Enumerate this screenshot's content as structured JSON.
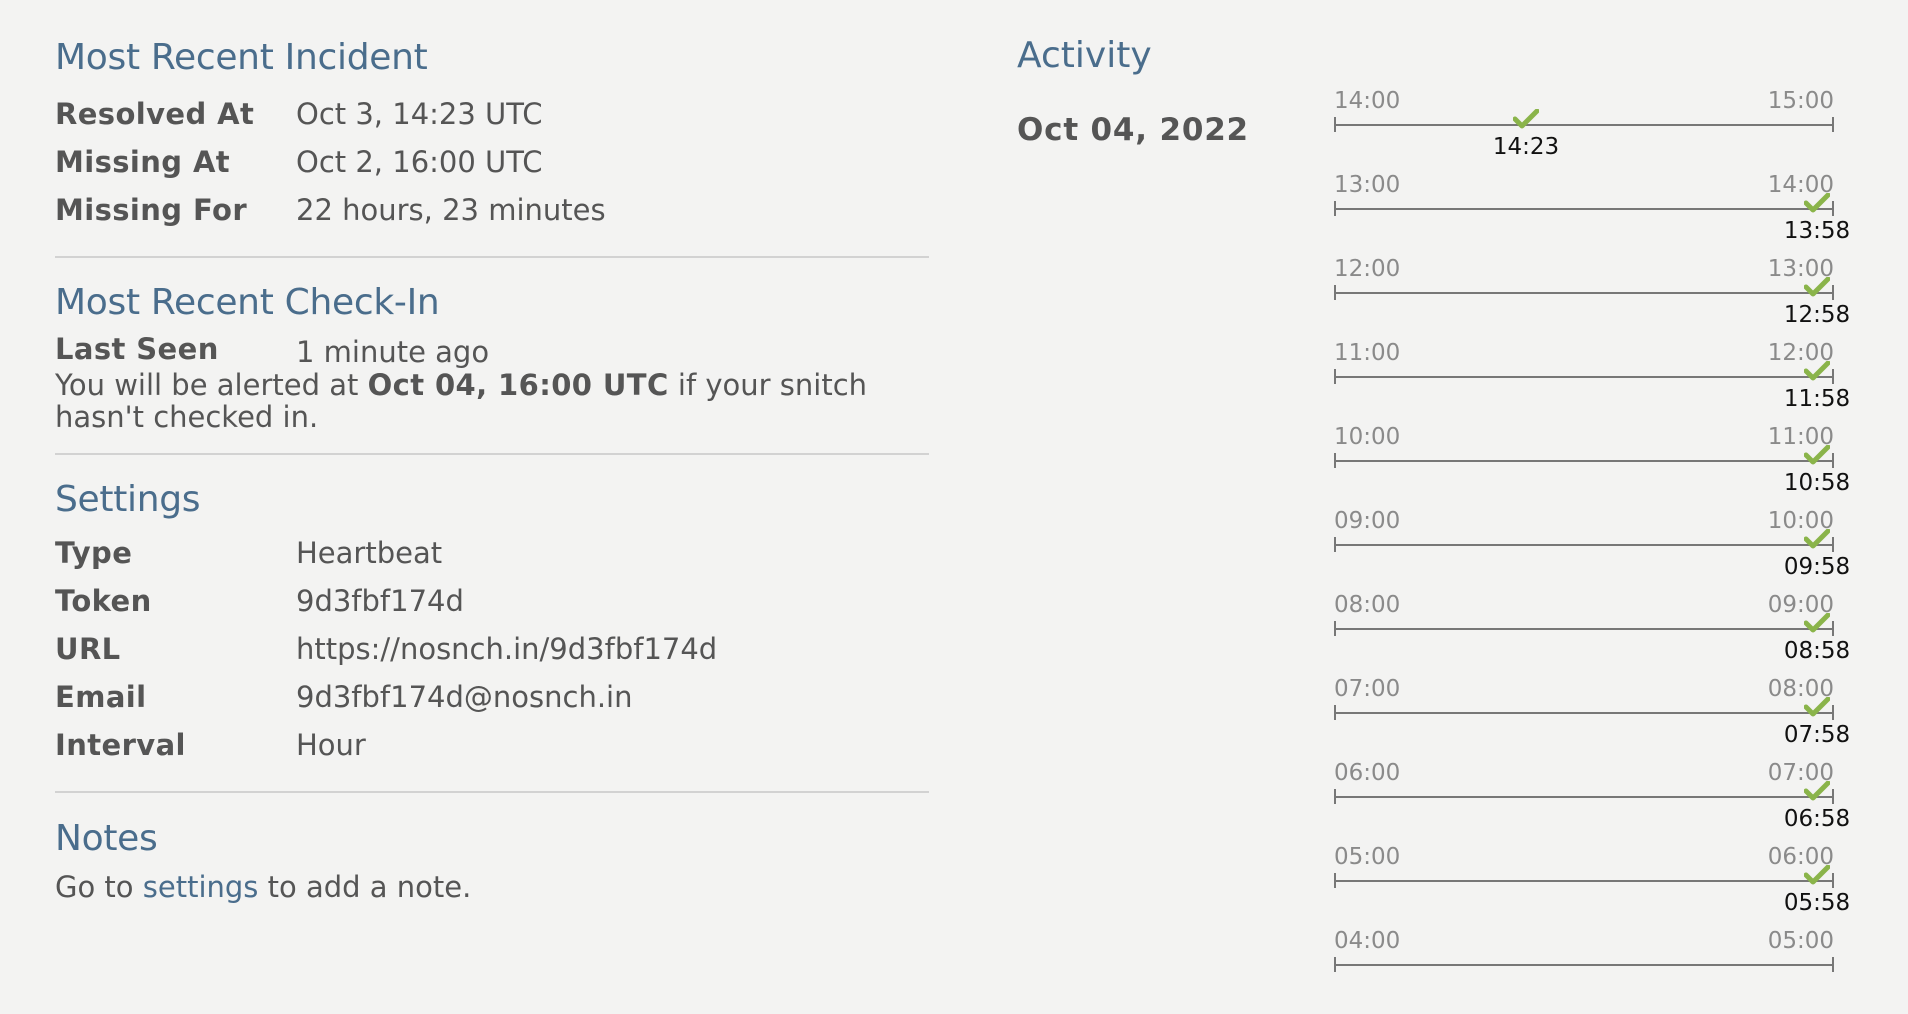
{
  "incident": {
    "title": "Most Recent Incident",
    "rows": [
      {
        "key": "Resolved At",
        "value": "Oct 3, 14:23 UTC"
      },
      {
        "key": "Missing At",
        "value": "Oct 2, 16:00 UTC"
      },
      {
        "key": "Missing For",
        "value": "22 hours, 23 minutes"
      }
    ]
  },
  "checkin": {
    "title": "Most Recent Check-In",
    "last_seen_key": "Last Seen",
    "last_seen_value": "1 minute ago",
    "alert_prefix": "You will be alerted at ",
    "alert_time": "Oct 04, 16:00 UTC",
    "alert_suffix": " if your snitch hasn't checked in."
  },
  "settings": {
    "title": "Settings",
    "rows": [
      {
        "key": "Type",
        "value": "Heartbeat"
      },
      {
        "key": "Token",
        "value": "9d3fbf174d"
      },
      {
        "key": "URL",
        "value": "https://nosnch.in/9d3fbf174d"
      },
      {
        "key": "Email",
        "value": "9d3fbf174d@nosnch.in"
      },
      {
        "key": "Interval",
        "value": "Hour"
      }
    ]
  },
  "notes": {
    "title": "Notes",
    "prefix": "Go to ",
    "link_label": "settings",
    "suffix": " to add a note."
  },
  "activity": {
    "title": "Activity",
    "date": "Oct 04, 2022",
    "check_color": "#8ab44a",
    "timelines": [
      {
        "start": "14:00",
        "end": "15:00",
        "checkin": "14:23",
        "fraction": 0.3833
      },
      {
        "start": "13:00",
        "end": "14:00",
        "checkin": "13:58",
        "fraction": 0.9667
      },
      {
        "start": "12:00",
        "end": "13:00",
        "checkin": "12:58",
        "fraction": 0.9667
      },
      {
        "start": "11:00",
        "end": "12:00",
        "checkin": "11:58",
        "fraction": 0.9667
      },
      {
        "start": "10:00",
        "end": "11:00",
        "checkin": "10:58",
        "fraction": 0.9667
      },
      {
        "start": "09:00",
        "end": "10:00",
        "checkin": "09:58",
        "fraction": 0.9667
      },
      {
        "start": "08:00",
        "end": "09:00",
        "checkin": "08:58",
        "fraction": 0.9667
      },
      {
        "start": "07:00",
        "end": "08:00",
        "checkin": "07:58",
        "fraction": 0.9667
      },
      {
        "start": "06:00",
        "end": "07:00",
        "checkin": "06:58",
        "fraction": 0.9667
      },
      {
        "start": "05:00",
        "end": "06:00",
        "checkin": "05:58",
        "fraction": 0.9667
      },
      {
        "start": "04:00",
        "end": "05:00",
        "checkin": "",
        "fraction": null
      }
    ]
  }
}
